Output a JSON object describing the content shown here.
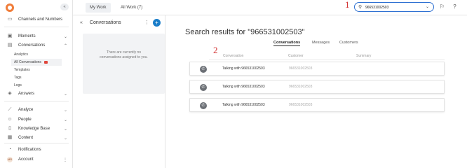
{
  "sidebar": {
    "channels": "Channels and Numbers",
    "items": [
      {
        "label": "Moments",
        "icon": "moments-icon"
      },
      {
        "label": "Conversations",
        "icon": "conversations-icon"
      },
      {
        "label": "Answers",
        "icon": "answers-icon"
      },
      {
        "label": "Analyze",
        "icon": "analyze-icon"
      },
      {
        "label": "People",
        "icon": "people-icon"
      },
      {
        "label": "Knowledge Base",
        "icon": "knowledge-base-icon"
      },
      {
        "label": "Content",
        "icon": "content-icon"
      }
    ],
    "sub_items": [
      "Analytics",
      "All Conversations",
      "Templates",
      "Tags",
      "Logs"
    ],
    "notifications": "Notifications",
    "account": "Account",
    "account_initials": "MR"
  },
  "topbar": {
    "tabs": [
      "My Work",
      "All Work (7)"
    ],
    "search_value": "966531002503",
    "annotation_1": "1"
  },
  "conversations_panel": {
    "title": "Conversations",
    "empty_text_line1": "There are currently no",
    "empty_text_line2": "conversations assigned to you."
  },
  "results": {
    "title": "Search results for \"966531002503\"",
    "tabs": [
      "Conversations",
      "Messages",
      "Customers"
    ],
    "columns": [
      "Conversation",
      "Customer",
      "Summary"
    ],
    "annotation_2": "2",
    "rows": [
      {
        "conversation": "Talking with 966531002503",
        "customer": "966531002503"
      },
      {
        "conversation": "Talking with 966531002503",
        "customer": "966531002503"
      },
      {
        "conversation": "Talking with 966531002503",
        "customer": "966531002503"
      }
    ]
  },
  "colors": {
    "accent": "#1a7dc9",
    "brand": "#f07d3a",
    "annotation": "#d23030",
    "badge": "#e0463c"
  }
}
